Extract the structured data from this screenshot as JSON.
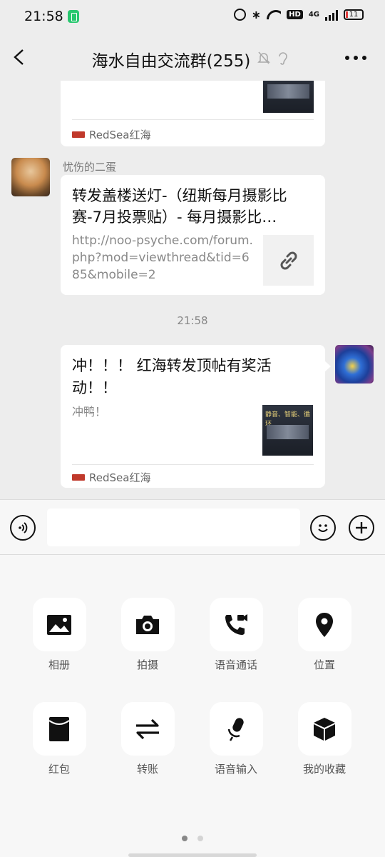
{
  "status_bar": {
    "time": "21:58",
    "network": "4G",
    "battery": "11"
  },
  "navbar": {
    "title": "海水自由交流群(255)"
  },
  "messages": [
    {
      "source": "RedSea红海"
    },
    {
      "sender": "忧伤的二蛋",
      "title": "转发盖楼送灯-（纽斯每月摄影比赛-7月投票贴）- 每月摄影比…",
      "url": "http://noo-psyche.com/forum.php?mod=viewthread&tid=685&mobile=2"
    },
    {
      "timestamp": "21:58"
    },
    {
      "title": "冲！！！ 红海转发顶帖有奖活动！！",
      "desc": "冲鸭！",
      "source": "RedSea红海",
      "thumb_text": "静音、智能、循环"
    }
  ],
  "tools": [
    {
      "label": "相册",
      "icon": "image-icon"
    },
    {
      "label": "拍摄",
      "icon": "camera-icon"
    },
    {
      "label": "语音通话",
      "icon": "phone-video-icon"
    },
    {
      "label": "位置",
      "icon": "location-pin-icon"
    },
    {
      "label": "红包",
      "icon": "red-envelope-icon"
    },
    {
      "label": "转账",
      "icon": "transfer-icon"
    },
    {
      "label": "语音输入",
      "icon": "microphone-icon"
    },
    {
      "label": "我的收藏",
      "icon": "cube-icon"
    }
  ],
  "page_indicator": {
    "pages": 2,
    "current": 1
  }
}
